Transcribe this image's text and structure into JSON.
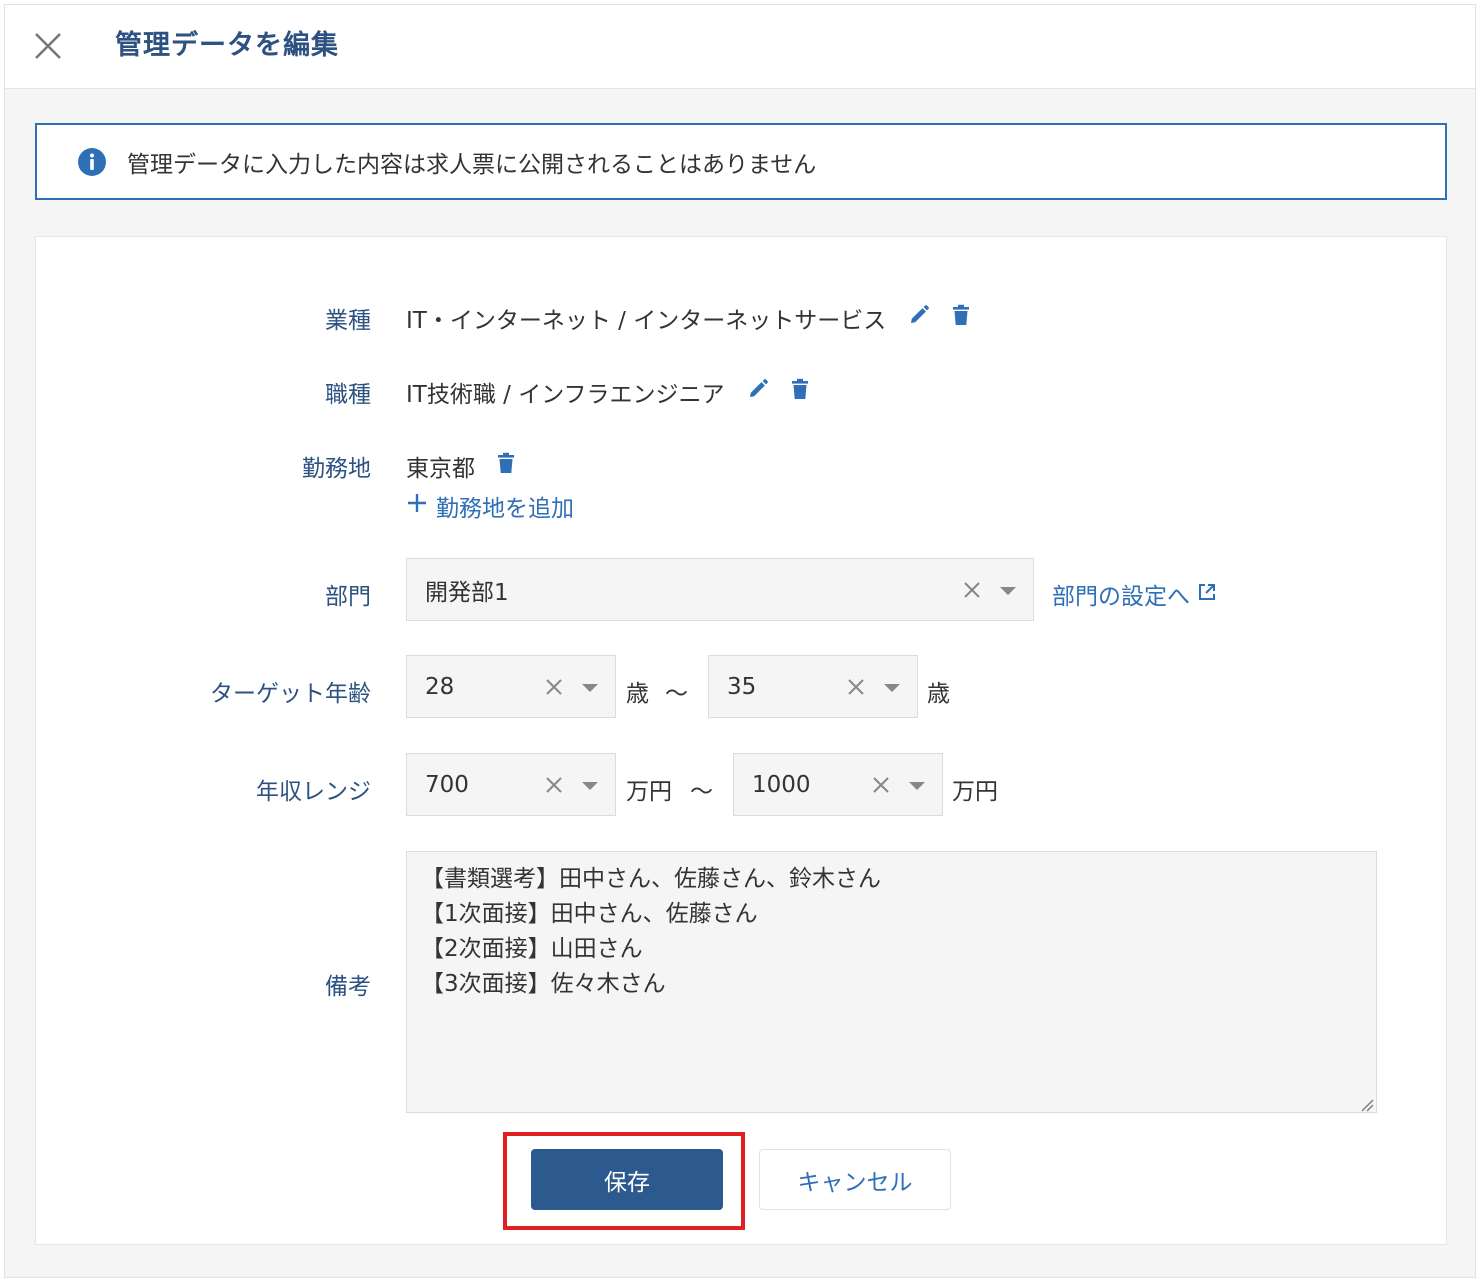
{
  "header": {
    "title": "管理データを編集",
    "close_icon": "close-icon"
  },
  "notice": {
    "icon": "info-icon",
    "text": "管理データに入力した内容は求人票に公開されることはありません"
  },
  "form": {
    "industry": {
      "label": "業種",
      "value": "IT・インターネット / インターネットサービス"
    },
    "occupation": {
      "label": "職種",
      "value": "IT技術職 / インフラエンジニア"
    },
    "location": {
      "label": "勤務地",
      "value": "東京都",
      "add_label": "勤務地を追加"
    },
    "department": {
      "label": "部門",
      "value": "開発部1",
      "settings_link": "部門の設定へ"
    },
    "target_age": {
      "label": "ターゲット年齢",
      "min": "28",
      "max": "35",
      "unit": "歳",
      "separator": "〜"
    },
    "salary_range": {
      "label": "年収レンジ",
      "min": "700",
      "max": "1000",
      "unit": "万円",
      "separator": "〜"
    },
    "notes": {
      "label": "備考",
      "value": "【書類選考】田中さん、佐藤さん、鈴木さん\n【1次面接】田中さん、佐藤さん\n【2次面接】山田さん\n【3次面接】佐々木さん"
    }
  },
  "actions": {
    "save_label": "保存",
    "cancel_label": "キャンセル"
  },
  "colors": {
    "accent": "#2f6fb6",
    "title": "#2d5281",
    "save_bg": "#2d5a8e",
    "highlight": "#e02020"
  }
}
